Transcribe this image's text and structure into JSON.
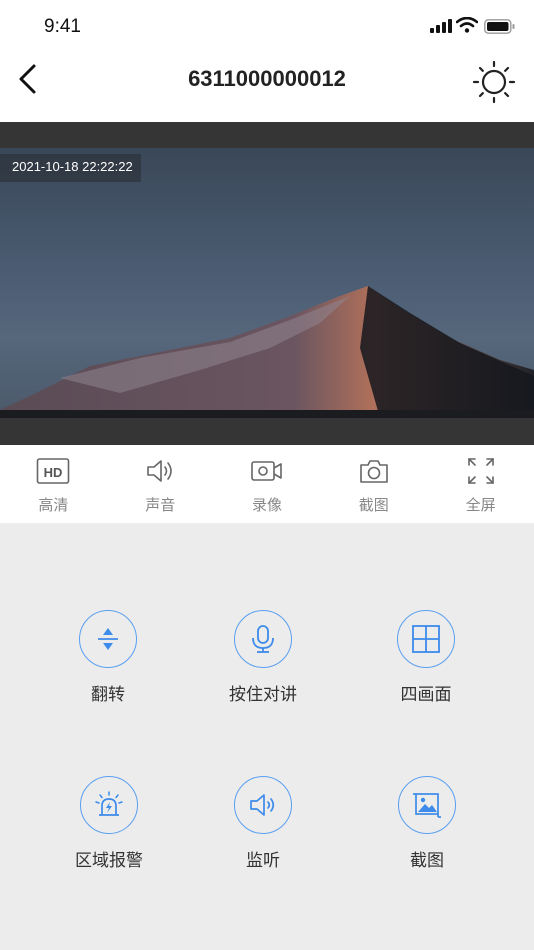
{
  "status_bar": {
    "time": "9:41"
  },
  "nav": {
    "title": "6311000000012"
  },
  "video": {
    "timestamp": "2021-10-18 22:22:22"
  },
  "toolbar": {
    "items": [
      {
        "label": "高清",
        "icon": "hd-icon"
      },
      {
        "label": "声音",
        "icon": "speaker-icon"
      },
      {
        "label": "录像",
        "icon": "video-record-icon"
      },
      {
        "label": "截图",
        "icon": "camera-icon"
      },
      {
        "label": "全屏",
        "icon": "fullscreen-icon"
      }
    ]
  },
  "controls": {
    "items": [
      {
        "label": "翻转",
        "icon": "flip-icon"
      },
      {
        "label": "按住对讲",
        "icon": "microphone-icon"
      },
      {
        "label": "四画面",
        "icon": "quad-view-icon"
      },
      {
        "label": "区域报警",
        "icon": "alarm-light-icon"
      },
      {
        "label": "监听",
        "icon": "speaker-icon"
      },
      {
        "label": "截图",
        "icon": "image-icon"
      }
    ]
  },
  "colors": {
    "accent": "#3d8bea",
    "toolbar_text": "#888888",
    "background": "#ececec"
  }
}
